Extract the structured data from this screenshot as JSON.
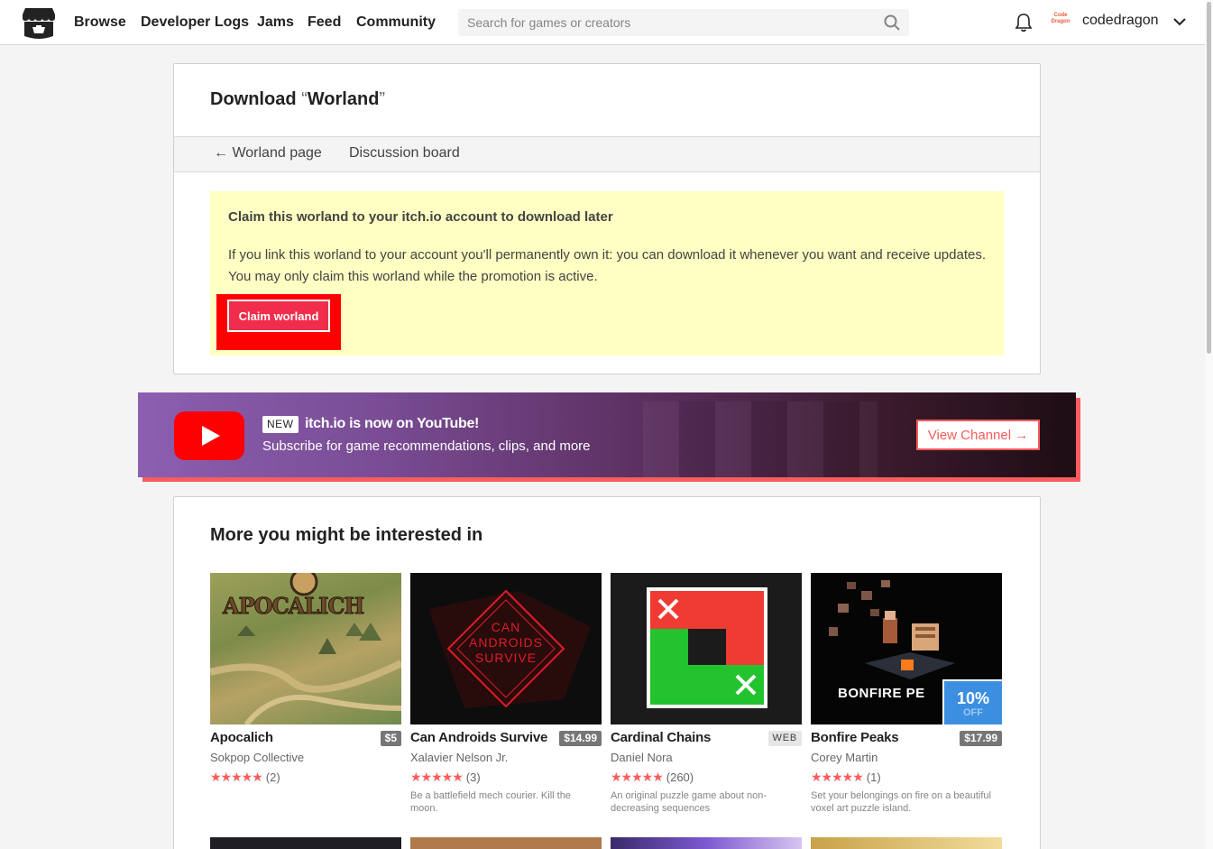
{
  "header": {
    "nav": [
      "Browse",
      "Developer Logs",
      "Jams",
      "Feed",
      "Community"
    ],
    "search_placeholder": "Search for games or creators",
    "avatar_text": "Code Dragon",
    "username": "codedragon"
  },
  "page": {
    "title_prefix": "Download ",
    "title_name": "Worland",
    "subnav_back": "Worland page",
    "subnav_discussion": "Discussion board"
  },
  "claim": {
    "title": "Claim this worland to your itch.io account to download later",
    "text": "If you link this worland to your account you'll permanently own it: you can download it whenever you want and receive updates. You may only claim this worland while the promotion is active.",
    "button": "Claim worland"
  },
  "banner": {
    "badge": "NEW",
    "title": "itch.io is now on YouTube!",
    "subtitle": "Subscribe for game recommendations, clips, and more",
    "button": "View Channel →"
  },
  "more": {
    "title": "More you might be interested in",
    "games": [
      {
        "title": "Apocalich",
        "price": "$5",
        "author": "Sokpop Collective",
        "stars": "★★★★★",
        "count": "(2)",
        "desc": "",
        "thumb_text": "APOCALICH"
      },
      {
        "title": "Can Androids Survive",
        "price": "$14.99",
        "author": "Xalavier Nelson Jr.",
        "stars": "★★★★★",
        "count": "(3)",
        "desc": "Be a battlefield mech courier. Kill the moon.",
        "thumb_text": "CAN ANDROIDS SURVIVE"
      },
      {
        "title": "Cardinal Chains",
        "price": "WEB",
        "author": "Daniel Nora",
        "stars": "★★★★★",
        "count": "(260)",
        "desc": "An original puzzle game about non-decreasing sequences",
        "thumb_text": ""
      },
      {
        "title": "Bonfire Peaks",
        "price": "$17.99",
        "author": "Corey Martin",
        "stars": "★★★★★",
        "count": "(1)",
        "desc": "Set your belongings on fire on a beautiful voxel art puzzle island.",
        "thumb_text": "BONFIRE PE",
        "sale_pct": "10%",
        "sale_off": "OFF"
      }
    ]
  },
  "colors": {
    "accent": "#fa5c5c",
    "claim_bg": "#ffffc3",
    "sale": "#3c8fe0"
  }
}
